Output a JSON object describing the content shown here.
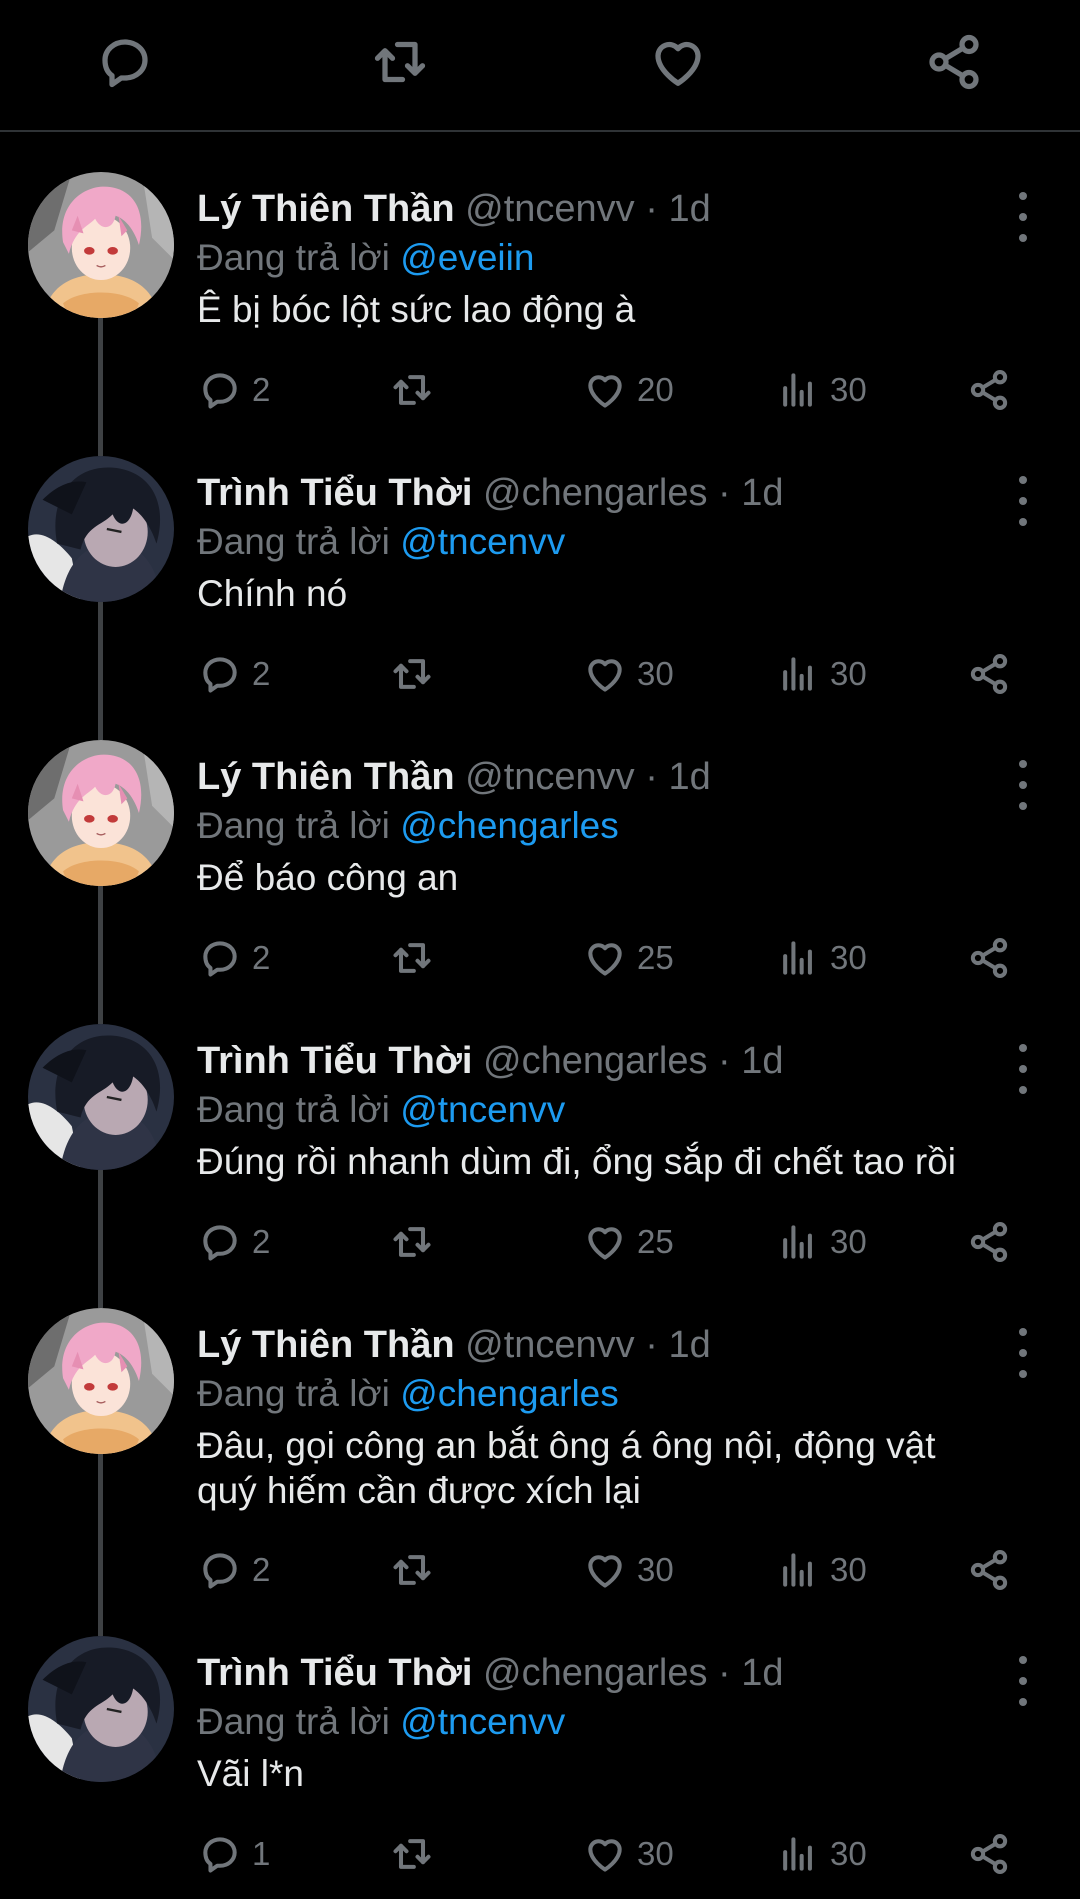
{
  "icons": {
    "reply": "reply-icon",
    "retweet": "retweet-icon",
    "like": "heart-icon",
    "views": "views-icon",
    "share": "share-icon",
    "more": "more-vertical-icon"
  },
  "colors": {
    "background": "#000000",
    "text": "#e7e9ea",
    "muted": "#71767b",
    "mention": "#1d9bf0",
    "divider": "#2f3336"
  },
  "replying_prefix": "Đang trả lời",
  "tweets": [
    {
      "name": "Lý Thiên Thần",
      "handle": "@tncenvv",
      "time": "· 1d",
      "replying_to": "@eveiin",
      "text": "Ê bị bóc lột sức lao động à",
      "replies": "2",
      "likes": "20",
      "views": "30"
    },
    {
      "name": "Trình Tiểu Thời",
      "handle": "@chengarles",
      "time": "· 1d",
      "replying_to": "@tncenvv",
      "text": "Chính nó",
      "replies": "2",
      "likes": "30",
      "views": "30"
    },
    {
      "name": "Lý Thiên Thần",
      "handle": "@tncenvv",
      "time": "· 1d",
      "replying_to": "@chengarles",
      "text": "Để báo công an",
      "replies": "2",
      "likes": "25",
      "views": "30"
    },
    {
      "name": "Trình Tiểu Thời",
      "handle": "@chengarles",
      "time": "· 1d",
      "replying_to": "@tncenvv",
      "text": "Đúng rồi nhanh dùm đi, ổng sắp đi chết tao rồi",
      "replies": "2",
      "likes": "25",
      "views": "30"
    },
    {
      "name": "Lý Thiên Thần",
      "handle": "@tncenvv",
      "time": "· 1d",
      "replying_to": "@chengarles",
      "text_lines": [
        "Đâu, gọi công an bắt ông á ông nội, động vật",
        "quý hiếm cần được xích lại"
      ],
      "replies": "2",
      "likes": "30",
      "views": "30"
    },
    {
      "name": "Trình Tiểu Thời",
      "handle": "@chengarles",
      "time": "· 1d",
      "replying_to": "@tncenvv",
      "text": "Vãi l*n",
      "replies": "1",
      "likes": "30",
      "views": "30"
    }
  ]
}
